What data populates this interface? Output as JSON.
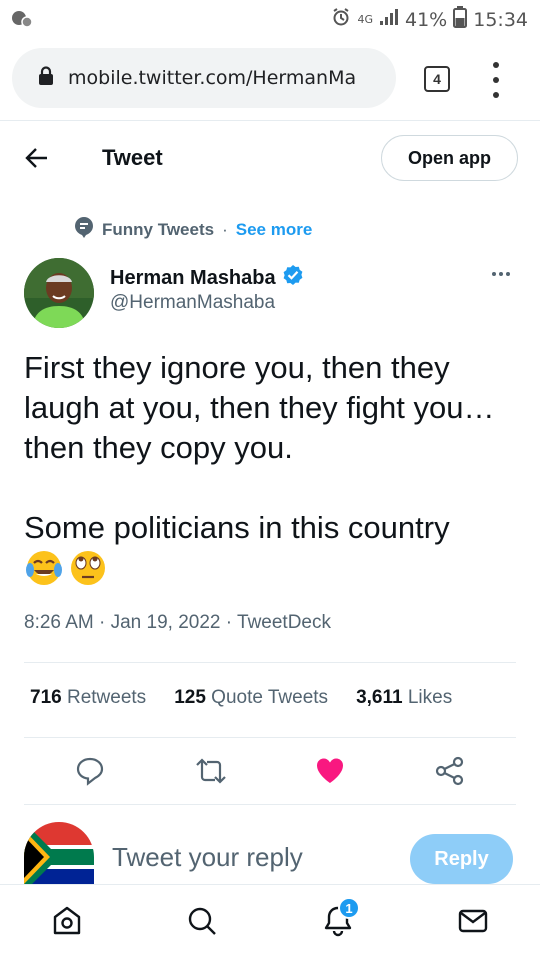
{
  "status_bar": {
    "network": "4G",
    "battery": "41%",
    "time": "15:34",
    "icons": [
      "notification-icon",
      "alarm-icon",
      "signal-icon",
      "battery-icon"
    ]
  },
  "browser": {
    "url": "mobile.twitter.com/HermanMa",
    "tab_count": "4"
  },
  "header": {
    "title": "Tweet",
    "open_app_label": "Open app"
  },
  "topic": {
    "name": "Funny Tweets",
    "separator": "·",
    "see_more": "See more"
  },
  "author": {
    "name": "Herman Mashaba",
    "handle": "@HermanMashaba",
    "verified": true
  },
  "tweet": {
    "paragraph1": "First they ignore you, then they laugh at you, then they fight you… then they copy you.",
    "paragraph2": "Some politicians in this country",
    "emojis": [
      "tears-of-joy-emoji",
      "rolling-eyes-emoji"
    ],
    "meta": "8:26 AM · Jan 19, 2022 · TweetDeck"
  },
  "stats": {
    "retweets_count": "716",
    "retweets_label": "Retweets",
    "quotes_count": "125",
    "quotes_label": "Quote Tweets",
    "likes_count": "3,611",
    "likes_label": "Likes"
  },
  "actions": [
    "reply-icon",
    "retweet-icon",
    "like-icon",
    "share-icon"
  ],
  "colors": {
    "accent": "#1d9bf0",
    "like": "#f91880",
    "reply_button": "#8ecdf8",
    "secondary_text": "#536471"
  },
  "reply": {
    "placeholder": "Tweet your reply",
    "button_label": "Reply"
  },
  "bottom_nav": {
    "items": [
      "home-icon",
      "search-icon",
      "notifications-icon",
      "messages-icon"
    ],
    "notifications_badge": "1"
  }
}
